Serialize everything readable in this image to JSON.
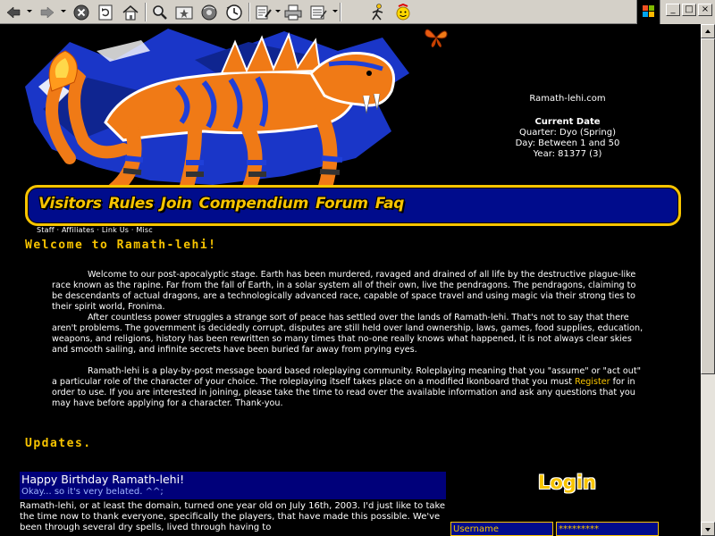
{
  "toolbar": {
    "icons": [
      "back-arrow-icon",
      "forward-arrow-icon",
      "stop-icon",
      "refresh-icon",
      "home-icon",
      "search-icon",
      "favorites-icon",
      "media-icon",
      "history-icon",
      "edit-icon",
      "print-icon",
      "notepad-icon",
      "aim-icon",
      "smiley-icon"
    ]
  },
  "window": {
    "minimize": "_",
    "maximize": "□",
    "close": "×"
  },
  "site_info": {
    "domain": "Ramath-lehi.com",
    "date_heading": "Current Date",
    "quarter": "Quarter: Dyo (Spring)",
    "day": "Day: Between 1 and 50",
    "year": "Year: 81377 (3)"
  },
  "nav": {
    "items": [
      "Visitors",
      "Rules",
      "Join",
      "Compendium",
      "Forum",
      "Faq"
    ],
    "sub": "Staff · Affiliates · Link Us · Misc"
  },
  "welcome": {
    "title": "Welcome to Ramath-lehi!",
    "p1": "Welcome to our post-apocalyptic stage. Earth has been murdered, ravaged and drained of all life by the destructive plague-like race known as the rapine. Far from the fall of Earth, in a solar system all of their own, live the pendragons. The pendragons, claiming to be descendants of actual dragons, are a technologically advanced race, capable of space travel and using magic via their strong ties to their spirit world, Fronima.",
    "p2": "After countless power struggles a strange sort of peace has settled over the lands of Ramath-lehi. That's not to say that there aren't problems. The government is decidedly corrupt, disputes are still held over land ownership, laws, games, food supplies, education, weapons, and religions, history has been rewritten so many times that no-one really knows what happened, it is not always clear skies and smooth sailing, and infinite secrets have been buried far away from prying eyes.",
    "p3_a": "Ramath-lehi is a play-by-post message board based roleplaying community. Roleplaying meaning that you \"assume\" or \"act out\" a particular role of the character of your choice. The roleplaying itself takes place on a modified Ikonboard that you must ",
    "p3_link": "Register",
    "p3_b": " for in order to use. If you are interested in joining, please take the time to read over the available information and ask any questions that you may have before applying for a character. Thank-you."
  },
  "updates": {
    "title": "Updates.",
    "news_title": "Happy Birthday Ramath-lehi!",
    "news_sub": "Okay... so it's very belated. ^^;",
    "news_body": "Ramath-lehi, or at least the domain, turned one year old on July 16th, 2003. I'd just like to take the time now to thank everyone, specifically the players, that have made this possible. We've been through several dry spells, lived through having to"
  },
  "login": {
    "title": "Login",
    "username": "Username",
    "password": "*********"
  },
  "colors": {
    "accent": "#f8c400",
    "nav_bg": "#000c8c",
    "news_bg": "#00007a",
    "page_bg": "#000000"
  }
}
